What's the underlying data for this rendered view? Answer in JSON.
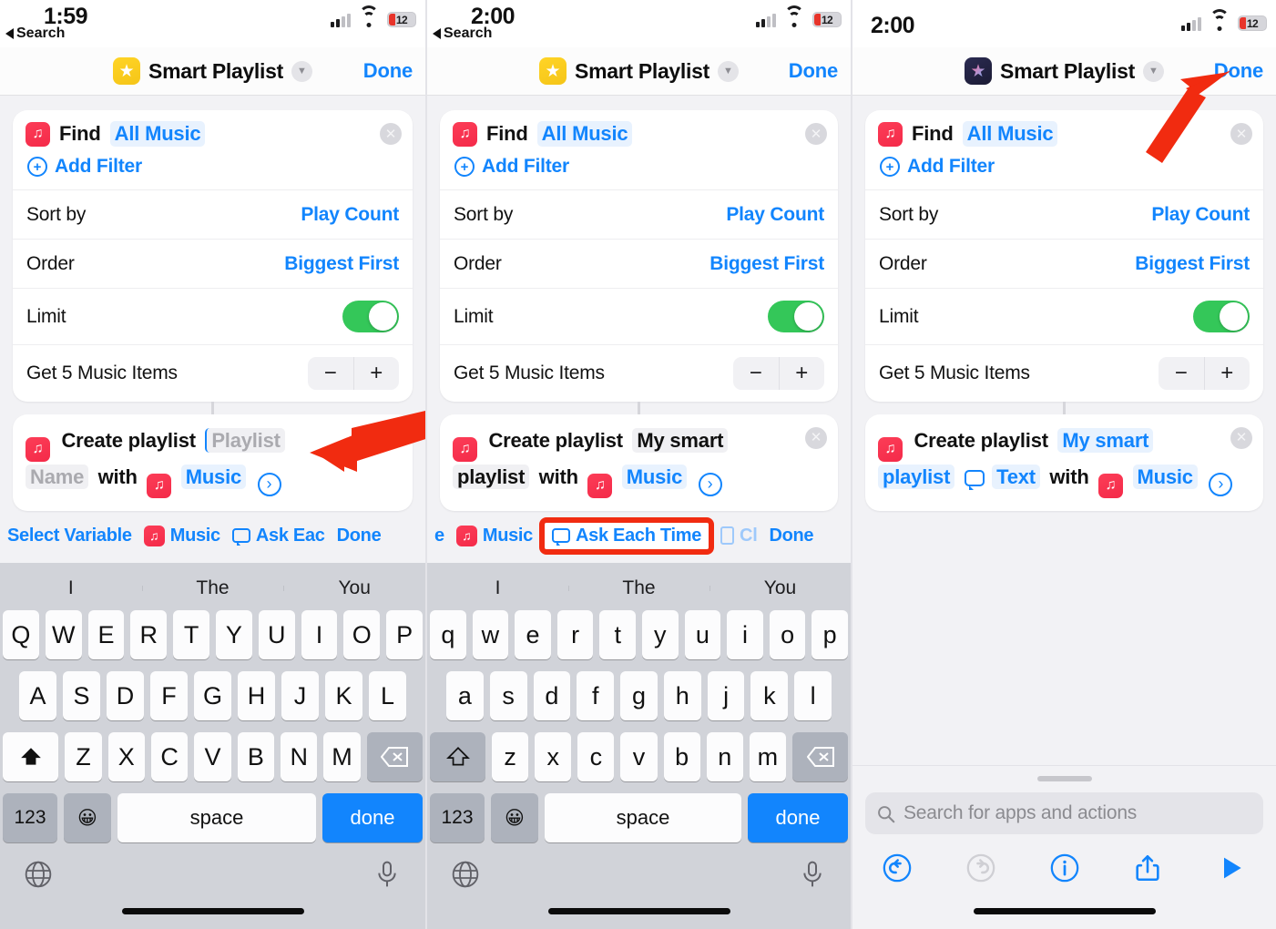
{
  "panels": [
    {
      "status": {
        "time": "1:59",
        "back": "Search",
        "battery": "12"
      },
      "nav": {
        "title": "Smart Playlist",
        "done": "Done",
        "icon": "shortcuts-yellow-icon"
      },
      "find_card": {
        "action": "Find",
        "target": "All Music",
        "add_filter": "Add Filter",
        "rows": [
          {
            "key": "Sort by",
            "value": "Play Count"
          },
          {
            "key": "Order",
            "value": "Biggest First"
          }
        ],
        "limit_label": "Limit",
        "limit_on": true,
        "get_items_label": "Get 5 Music Items",
        "minus": "−",
        "plus": "+"
      },
      "create_card": {
        "action": "Create playlist",
        "name_value": "Playlist",
        "name_value2": "Name",
        "name_is_placeholder": true,
        "with": "with",
        "source": "Music",
        "chevron": "›"
      },
      "varbar": [
        {
          "label": "Select Variable",
          "icon": null,
          "highlight": false
        },
        {
          "label": "Music",
          "icon": "music-icon",
          "highlight": false
        },
        {
          "label": "Ask Eac",
          "icon": "message-icon",
          "highlight": false
        },
        {
          "label": "Done",
          "icon": null,
          "highlight": false
        }
      ],
      "keyboard": {
        "predictions": [
          "I",
          "The",
          "You"
        ],
        "row1": [
          "Q",
          "W",
          "E",
          "R",
          "T",
          "Y",
          "U",
          "I",
          "O",
          "P"
        ],
        "row2": [
          "A",
          "S",
          "D",
          "F",
          "G",
          "H",
          "J",
          "K",
          "L"
        ],
        "row3": [
          "Z",
          "X",
          "C",
          "V",
          "B",
          "N",
          "M"
        ],
        "numbers_key": "123",
        "space_key": "space",
        "done_key": "done",
        "shift_active": true
      }
    },
    {
      "status": {
        "time": "2:00",
        "back": "Search",
        "battery": "12"
      },
      "nav": {
        "title": "Smart Playlist",
        "done": "Done",
        "icon": "shortcuts-yellow-icon"
      },
      "find_card": {
        "action": "Find",
        "target": "All Music",
        "add_filter": "Add Filter",
        "rows": [
          {
            "key": "Sort by",
            "value": "Play Count"
          },
          {
            "key": "Order",
            "value": "Biggest First"
          }
        ],
        "limit_label": "Limit",
        "limit_on": true,
        "get_items_label": "Get 5 Music Items",
        "minus": "−",
        "plus": "+"
      },
      "create_card": {
        "action": "Create playlist",
        "name_value": "My smart",
        "name_value2": "playlist",
        "name_is_placeholder": false,
        "with": "with",
        "source": "Music",
        "chevron": "›"
      },
      "varbar": [
        {
          "label": "e",
          "icon": null,
          "highlight": false
        },
        {
          "label": "Music",
          "icon": "music-icon",
          "highlight": false
        },
        {
          "label": "Ask Each Time",
          "icon": "message-icon",
          "highlight": true
        },
        {
          "label": "Cl",
          "icon": "clipboard-icon",
          "highlight": false
        },
        {
          "label": "Done",
          "icon": null,
          "highlight": false
        }
      ],
      "keyboard": {
        "predictions": [
          "I",
          "The",
          "You"
        ],
        "row1": [
          "q",
          "w",
          "e",
          "r",
          "t",
          "y",
          "u",
          "i",
          "o",
          "p"
        ],
        "row2": [
          "a",
          "s",
          "d",
          "f",
          "g",
          "h",
          "j",
          "k",
          "l"
        ],
        "row3": [
          "z",
          "x",
          "c",
          "v",
          "b",
          "n",
          "m"
        ],
        "numbers_key": "123",
        "space_key": "space",
        "done_key": "done",
        "shift_active": false
      }
    },
    {
      "status": {
        "time": "2:00",
        "back": null,
        "battery": "12"
      },
      "nav": {
        "title": "Smart Playlist",
        "done": "Done",
        "icon": "shortcuts-dark-icon"
      },
      "find_card": {
        "action": "Find",
        "target": "All Music",
        "add_filter": "Add Filter",
        "rows": [
          {
            "key": "Sort by",
            "value": "Play Count"
          },
          {
            "key": "Order",
            "value": "Biggest First"
          }
        ],
        "limit_label": "Limit",
        "limit_on": true,
        "get_items_label": "Get 5 Music Items",
        "minus": "−",
        "plus": "+"
      },
      "create_card": {
        "action": "Create playlist",
        "name_value": "My smart",
        "name_value2": "playlist",
        "variable_token": "Text",
        "name_is_placeholder": false,
        "with": "with",
        "source": "Music",
        "chevron": "›"
      },
      "sheet": {
        "search_placeholder": "Search for apps and actions",
        "toolbar": [
          "undo-icon",
          "redo-icon",
          "info-icon",
          "share-icon",
          "play-icon"
        ]
      }
    }
  ],
  "annotations": {
    "arrow1": "red-arrow-pointing-to-playlist-name-field",
    "arrow2": "red-box-highlight-ask-each-time",
    "arrow3": "red-arrow-pointing-to-done-button"
  },
  "colors": {
    "accent_blue": "#1285fd",
    "annotation_red": "#f12b10",
    "toggle_green": "#34c759",
    "music_red": "#fc3d57"
  }
}
